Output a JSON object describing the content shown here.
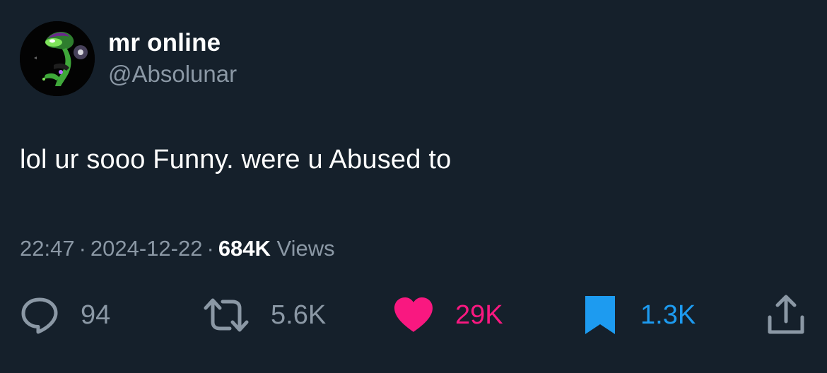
{
  "author": {
    "display_name": "mr online",
    "handle": "@Absolunar"
  },
  "tweet": {
    "text": "lol ur sooo Funny. were u Abused to"
  },
  "meta": {
    "time": "22:47",
    "separator": "·",
    "date": "2024-12-22",
    "views_count": "684K",
    "views_label": "Views"
  },
  "actions": {
    "replies": "94",
    "retweets": "5.6K",
    "likes": "29K",
    "bookmarks": "1.3K"
  },
  "colors": {
    "background": "#15202b",
    "secondary_text": "#8b98a5",
    "like": "#f91880",
    "bookmark": "#1d9bf0"
  },
  "icons": {
    "reply": "reply-bubble-icon",
    "retweet": "retweet-icon",
    "like": "heart-icon",
    "bookmark": "bookmark-icon",
    "share": "share-icon"
  }
}
